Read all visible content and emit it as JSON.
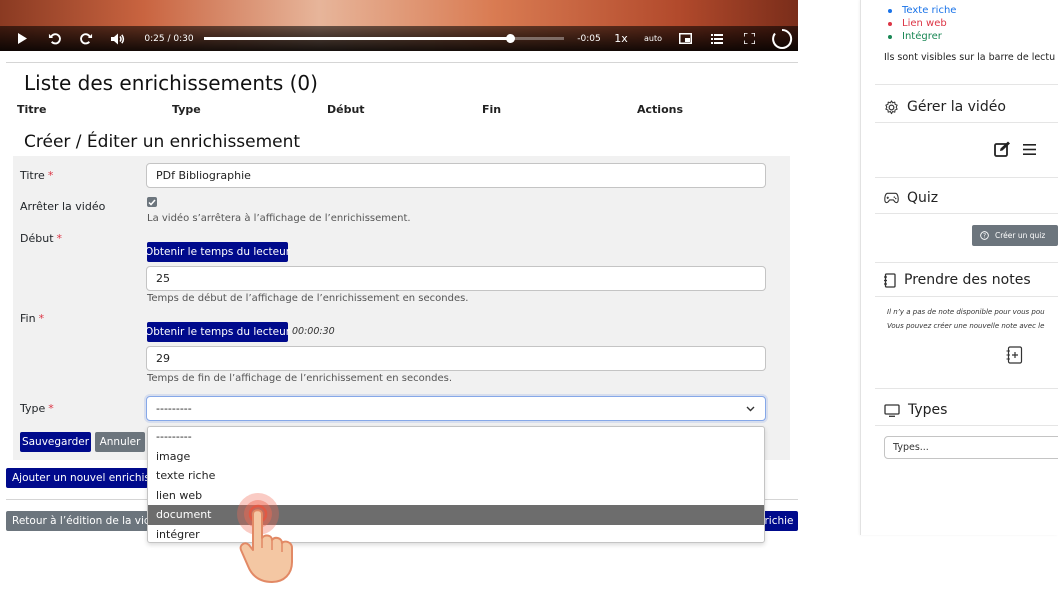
{
  "player": {
    "current_time": "0:25",
    "separator": "/",
    "duration": "0:30",
    "remaining": "-0:05",
    "speed": "1x",
    "quality": "auto",
    "progress_fraction": 0.85
  },
  "enrichment_list": {
    "title": "Liste des enrichissements (0)",
    "columns": [
      "Titre",
      "Type",
      "Début",
      "Fin",
      "Actions"
    ]
  },
  "form": {
    "title": "Créer / Éditer un enrichissement",
    "required_mark": "*",
    "titre": {
      "label": "Titre",
      "value": "PDf Bibliographie"
    },
    "stop_video": {
      "label": "Arrêter la vidéo",
      "checked": true,
      "help": "La vidéo s’arrêtera à l’affichage de l’enrichissement."
    },
    "debut": {
      "label": "Début",
      "button": "Obtenir le temps du lecteur",
      "value": "25",
      "help": "Temps de début de l’affichage de l’enrichissement en secondes."
    },
    "fin": {
      "label": "Fin",
      "button": "Obtenir le temps du lecteur",
      "time_display": "00:00:30",
      "value": "29",
      "help": "Temps de fin de l’affichage de l’enrichissement en secondes."
    },
    "type": {
      "label": "Type",
      "value": "---------",
      "options": [
        "---------",
        "image",
        "texte riche",
        "lien web",
        "document",
        "intégrer"
      ],
      "highlighted_option": "document"
    },
    "save_button": "Sauvegarder",
    "cancel_button": "Annuler"
  },
  "actions": {
    "add_new": "Ajouter un nouvel enrichisse",
    "back_to_edit": "Retour à l’édition de la vidéo",
    "right_fragment": "richie"
  },
  "sidebar": {
    "type_list": [
      {
        "label": "Texte riche",
        "color": "#1a73e8"
      },
      {
        "label": "Lien web",
        "color": "#dc3545"
      },
      {
        "label": "Intégrer",
        "color": "#198754"
      }
    ],
    "visible_note": "Ils sont visibles sur la barre de lectu",
    "manage_video": {
      "title": "Gérer la vidéo"
    },
    "quiz": {
      "title": "Quiz",
      "button": "Créer un quiz"
    },
    "notes": {
      "title": "Prendre des notes",
      "line1": "Il n’y a pas de note disponible pour vous pou",
      "line2": "Vous pouvez créer une nouvelle note avec le"
    },
    "types": {
      "title": "Types",
      "placeholder": "Types..."
    }
  },
  "colors": {
    "primary": "#000a8c",
    "secondary": "#6c757d",
    "required": "#dc3545",
    "highlight": "#6d6d6d"
  }
}
